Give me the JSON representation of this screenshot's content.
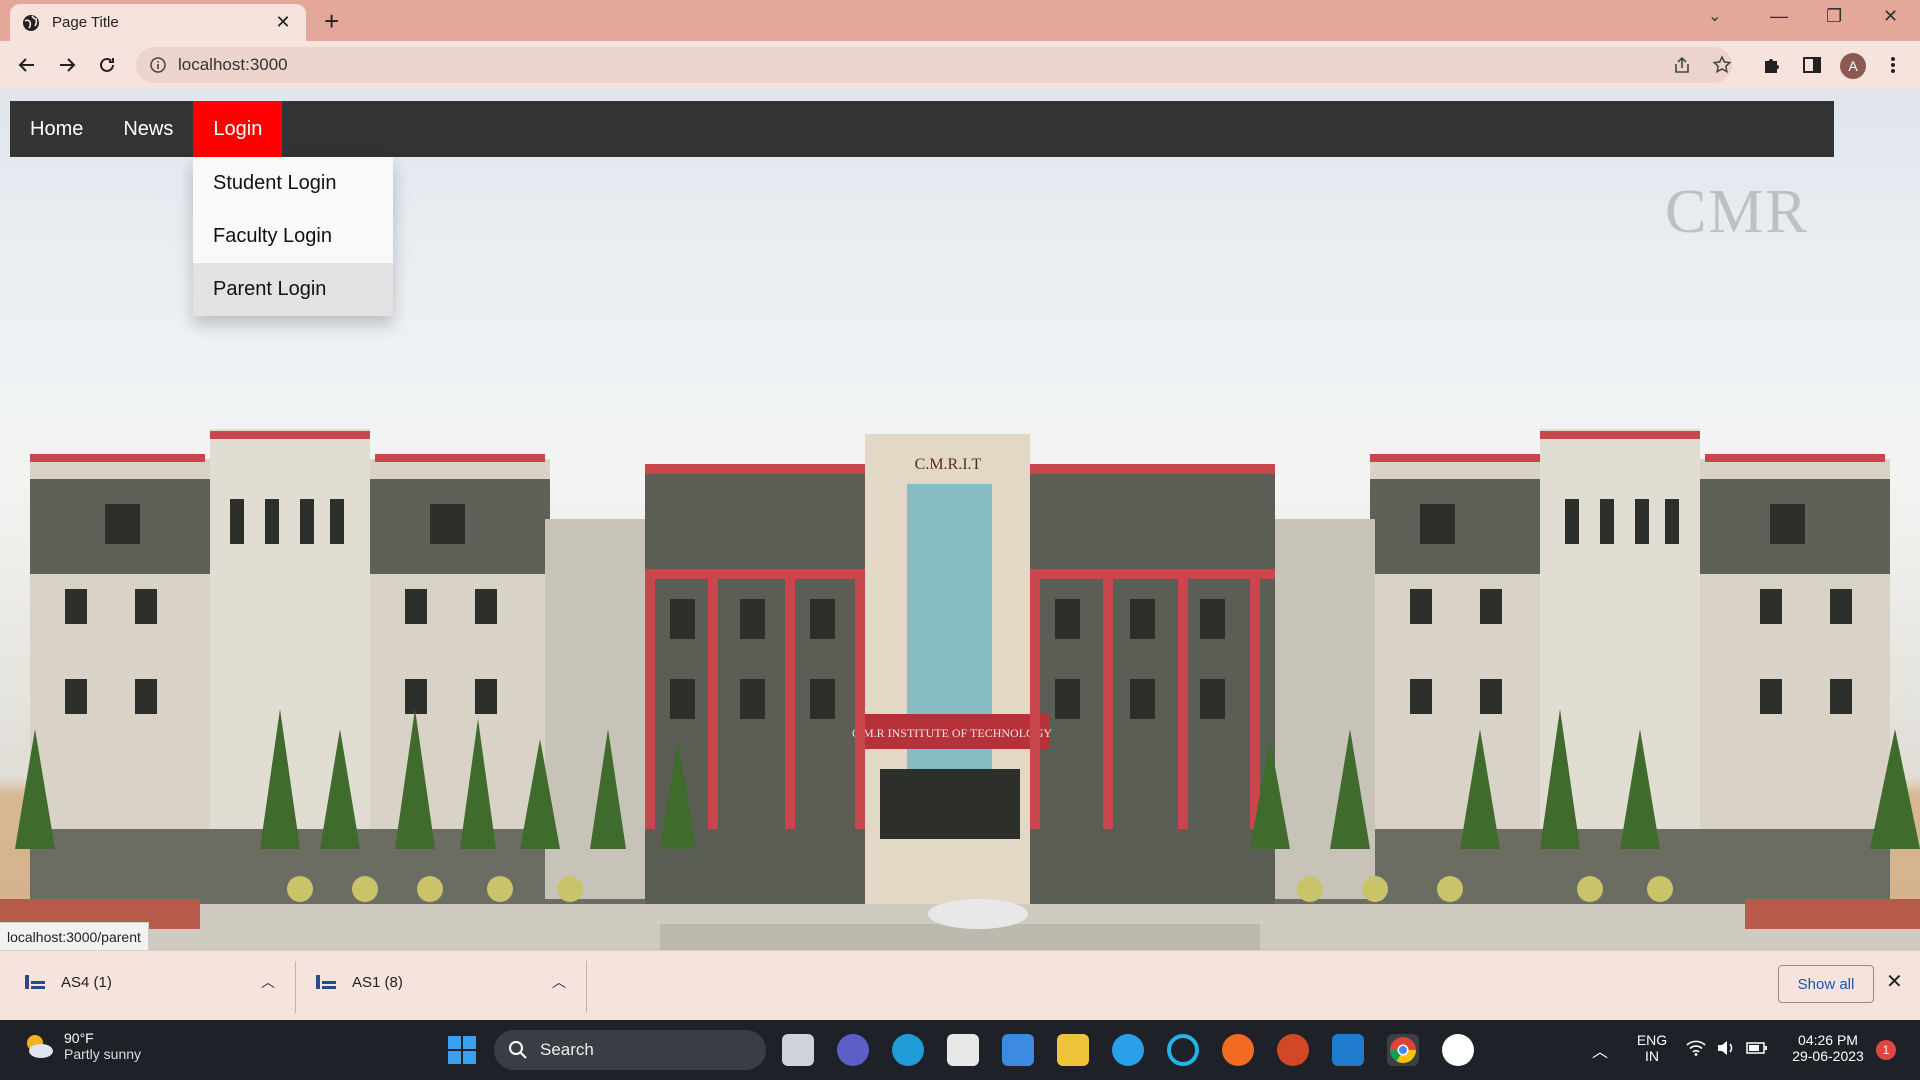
{
  "browser": {
    "tab_title": "Page Title",
    "url": "localhost:3000",
    "profile_initial": "A"
  },
  "navbar": {
    "items": [
      {
        "label": "Home",
        "active": false
      },
      {
        "label": "News",
        "active": false
      },
      {
        "label": "Login",
        "active": true
      }
    ]
  },
  "dropdown": {
    "items": [
      {
        "label": "Student Login"
      },
      {
        "label": "Faculty Login"
      },
      {
        "label": "Parent Login",
        "hovered": true
      }
    ]
  },
  "hero": {
    "watermark": "CMR",
    "building_sign_top": "C.M.R.I.T",
    "building_sign_bottom": "C.M.R INSTITUTE OF TECHNOLOGY"
  },
  "status_bar": {
    "link_url": "localhost:3000/parent"
  },
  "downloads": {
    "items": [
      {
        "name": "AS4 (1)"
      },
      {
        "name": "AS1 (8)"
      }
    ],
    "show_all_label": "Show all"
  },
  "taskbar": {
    "weather": {
      "temp": "90°F",
      "desc": "Partly sunny"
    },
    "search_label": "Search",
    "language": {
      "line1": "ENG",
      "line2": "IN"
    },
    "time": "04:26 PM",
    "date": "29-06-2023",
    "notification_count": "1"
  },
  "colors": {
    "navbar_bg": "#333333",
    "active_nav": "#ff0000",
    "chrome_tab_strip": "#e3a89a",
    "chrome_toolbar": "#f6e3dd"
  }
}
